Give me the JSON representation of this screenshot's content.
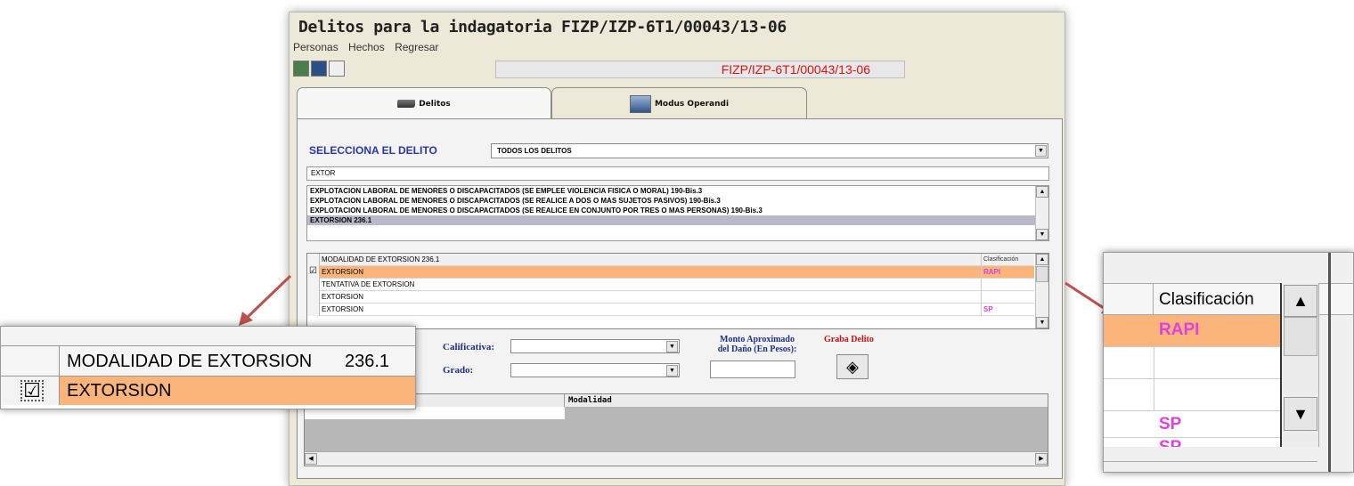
{
  "window": {
    "title": "Delitos para la indagatoria FIZP/IZP-6T1/00043/13-06",
    "menu": [
      "Personas",
      "Hechos",
      "Regresar"
    ],
    "expediente": "FIZP/IZP-6T1/00043/13-06"
  },
  "tabs": [
    {
      "label": "Delitos"
    },
    {
      "label": "Modus Operandi"
    }
  ],
  "form": {
    "select_label": "SELECCIONA EL DELITO",
    "select_value": "TODOS LOS DELITOS",
    "search_value": "EXTOR",
    "crime_list": [
      "EXPLOTACION LABORAL DE MENORES O DISCAPACITADOS (SE EMPLEE VIOLENCIA FISICA O MORAL)   190-Bis.3",
      "EXPLOTACION LABORAL DE MENORES O DISCAPACITADOS (SE REALICE A DOS O MAS SUJETOS PASIVOS)   190-Bis.3",
      "EXPLOTACION LABORAL DE MENORES O DISCAPACITADOS (SE REALICE EN CONJUNTO POR TRES O MAS PERSONAS)   190-Bis.3",
      "EXTORSION   236.1"
    ],
    "grid": {
      "header_modalidad": "MODALIDAD DE EXTORSION   236.1",
      "header_clasificacion": "Clasificación",
      "rows": [
        {
          "modalidad": "EXTORSION",
          "clasificacion": "RAPI"
        },
        {
          "modalidad": "TENTATIVA DE EXTORSION",
          "clasificacion": ""
        },
        {
          "modalidad": "EXTORSION",
          "clasificacion": ""
        },
        {
          "modalidad": "EXTORSION",
          "clasificacion": "SP"
        }
      ]
    },
    "calificativa_label": "Calificativa:",
    "grado_label": "Grado:",
    "monto_label_1": "Monto Aproximado",
    "monto_label_2": "del Daño (En Pesos):",
    "graba_label": "Graba Delito",
    "bottom_header": "Modalidad"
  },
  "zoom_left": {
    "header": "MODALIDAD DE EXTORSION",
    "code": "236.1",
    "row": "EXTORSION"
  },
  "zoom_right": {
    "header": "Clasificación",
    "rows": [
      "RAPI",
      "",
      "",
      "SP",
      "SP"
    ]
  },
  "colors": {
    "selected_row": "#fbb57b",
    "expediente_text": "#e01010",
    "label_blue": "#2a37a8",
    "clasificacion_text": "#e040e0",
    "arrow": "#c0504d"
  }
}
